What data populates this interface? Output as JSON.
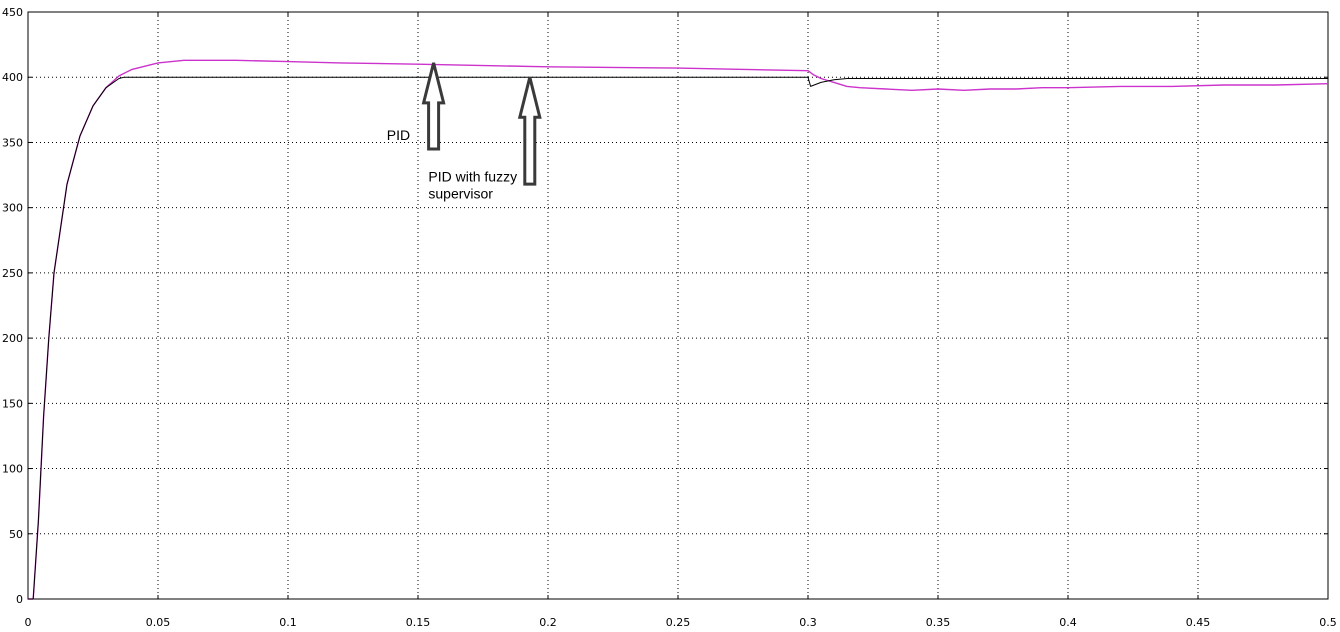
{
  "chart_data": {
    "type": "line",
    "title": "",
    "xlabel": "",
    "ylabel": "",
    "xlim": [
      0,
      0.5
    ],
    "ylim": [
      0,
      450
    ],
    "grid": true,
    "x_ticks": [
      0,
      0.05,
      0.1,
      0.15,
      0.2,
      0.25,
      0.3,
      0.35,
      0.4,
      0.45,
      0.5
    ],
    "x_tick_labels": [
      "0",
      "0.05",
      "0.1",
      "0.15",
      "0.2",
      "0.25",
      "0.3",
      "0.35",
      "0.4",
      "0.45",
      "0.5"
    ],
    "y_ticks": [
      0,
      50,
      100,
      150,
      200,
      250,
      300,
      350,
      400,
      450
    ],
    "y_tick_labels": [
      "0",
      "50",
      "100",
      "150",
      "200",
      "250",
      "300",
      "350",
      "400",
      "450"
    ],
    "series": [
      {
        "color": "#cc33cc",
        "x": [
          0,
          0.002,
          0.004,
          0.006,
          0.008,
          0.01,
          0.015,
          0.02,
          0.025,
          0.03,
          0.035,
          0.04,
          0.05,
          0.06,
          0.07,
          0.08,
          0.1,
          0.12,
          0.15,
          0.2,
          0.25,
          0.3,
          0.302,
          0.305,
          0.31,
          0.315,
          0.32,
          0.33,
          0.34,
          0.35,
          0.36,
          0.37,
          0.38,
          0.39,
          0.4,
          0.42,
          0.44,
          0.46,
          0.48,
          0.5
        ],
        "y": [
          0,
          0,
          60,
          140,
          200,
          250,
          318,
          355,
          378,
          392,
          401,
          406,
          411,
          413,
          413,
          413,
          412,
          411,
          410,
          408,
          407,
          405,
          402,
          399,
          396,
          393,
          392,
          391,
          390,
          391,
          390,
          391,
          391,
          392,
          392,
          393,
          393,
          394,
          394,
          395
        ]
      },
      {
        "color": "#000000",
        "x": [
          0,
          0.002,
          0.004,
          0.006,
          0.008,
          0.01,
          0.015,
          0.02,
          0.025,
          0.03,
          0.035,
          0.037,
          0.3,
          0.301,
          0.305,
          0.31,
          0.315,
          0.32,
          0.5
        ],
        "y": [
          0,
          0,
          60,
          140,
          200,
          250,
          318,
          355,
          378,
          392,
          399,
          400,
          400,
          393,
          396,
          398,
          399,
          399,
          399
        ]
      }
    ],
    "annotations": [
      {
        "text": "PID",
        "x": 0.138,
        "y": 352,
        "arrow_tip": [
          0.156,
          411
        ],
        "arrow_tail": [
          0.156,
          345
        ]
      },
      {
        "text_lines": [
          "PID with fuzzy",
          "supervisor"
        ],
        "x": 0.154,
        "y": 320,
        "arrow_tip": [
          0.193,
          400
        ],
        "arrow_tail": [
          0.193,
          318
        ]
      }
    ]
  }
}
